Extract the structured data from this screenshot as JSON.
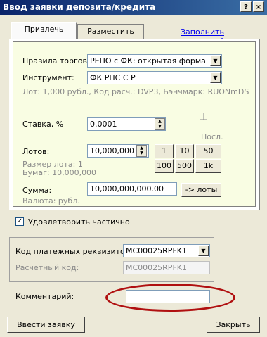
{
  "window": {
    "title": "Ввод заявки депозита/кредита",
    "help_btn": "?",
    "close_btn": "×"
  },
  "tabs": {
    "attract": "Привлечь",
    "place": "Разместить",
    "fill_last": "Заполнить последней"
  },
  "form": {
    "trade_rules_label": "Правила торгов:",
    "trade_rules_value": "РЕПО с ФК: открытая форма",
    "instrument_label": "Инструмент:",
    "instrument_value": "ФК РПС С Р",
    "instrument_info": "Лот: 1,000 рубл., Код расч.: DVP3, Бэнчмарк: RUONmDS",
    "rate_label": "Ставка, %",
    "rate_value": "0.0001",
    "last_label": "Посл.",
    "lots_label": "Лотов:",
    "lots_value": "10,000,000",
    "lot_size_info": "Размер лота: 1",
    "papers_info": "Бумаг: 10,000,000",
    "lot_buttons": [
      "1",
      "10",
      "50",
      "100",
      "500",
      "1k"
    ],
    "sum_label": "Сумма:",
    "sum_value": "10,000,000,000.00",
    "to_lots_button": "-> лоты",
    "currency_info": "Валюта: рубл."
  },
  "partial": {
    "label": "Удовлетворить частично",
    "checked": true,
    "mark": "✓"
  },
  "requisites": {
    "code_label": "Код платежных реквизитов:",
    "code_value": "MC00025RPFK1",
    "settle_label": "Расчетный код:",
    "settle_value": "MC00025RPFK1"
  },
  "comment": {
    "label": "Комментарий:",
    "value": ""
  },
  "footer": {
    "submit": "Ввести заявку",
    "close": "Закрыть"
  }
}
